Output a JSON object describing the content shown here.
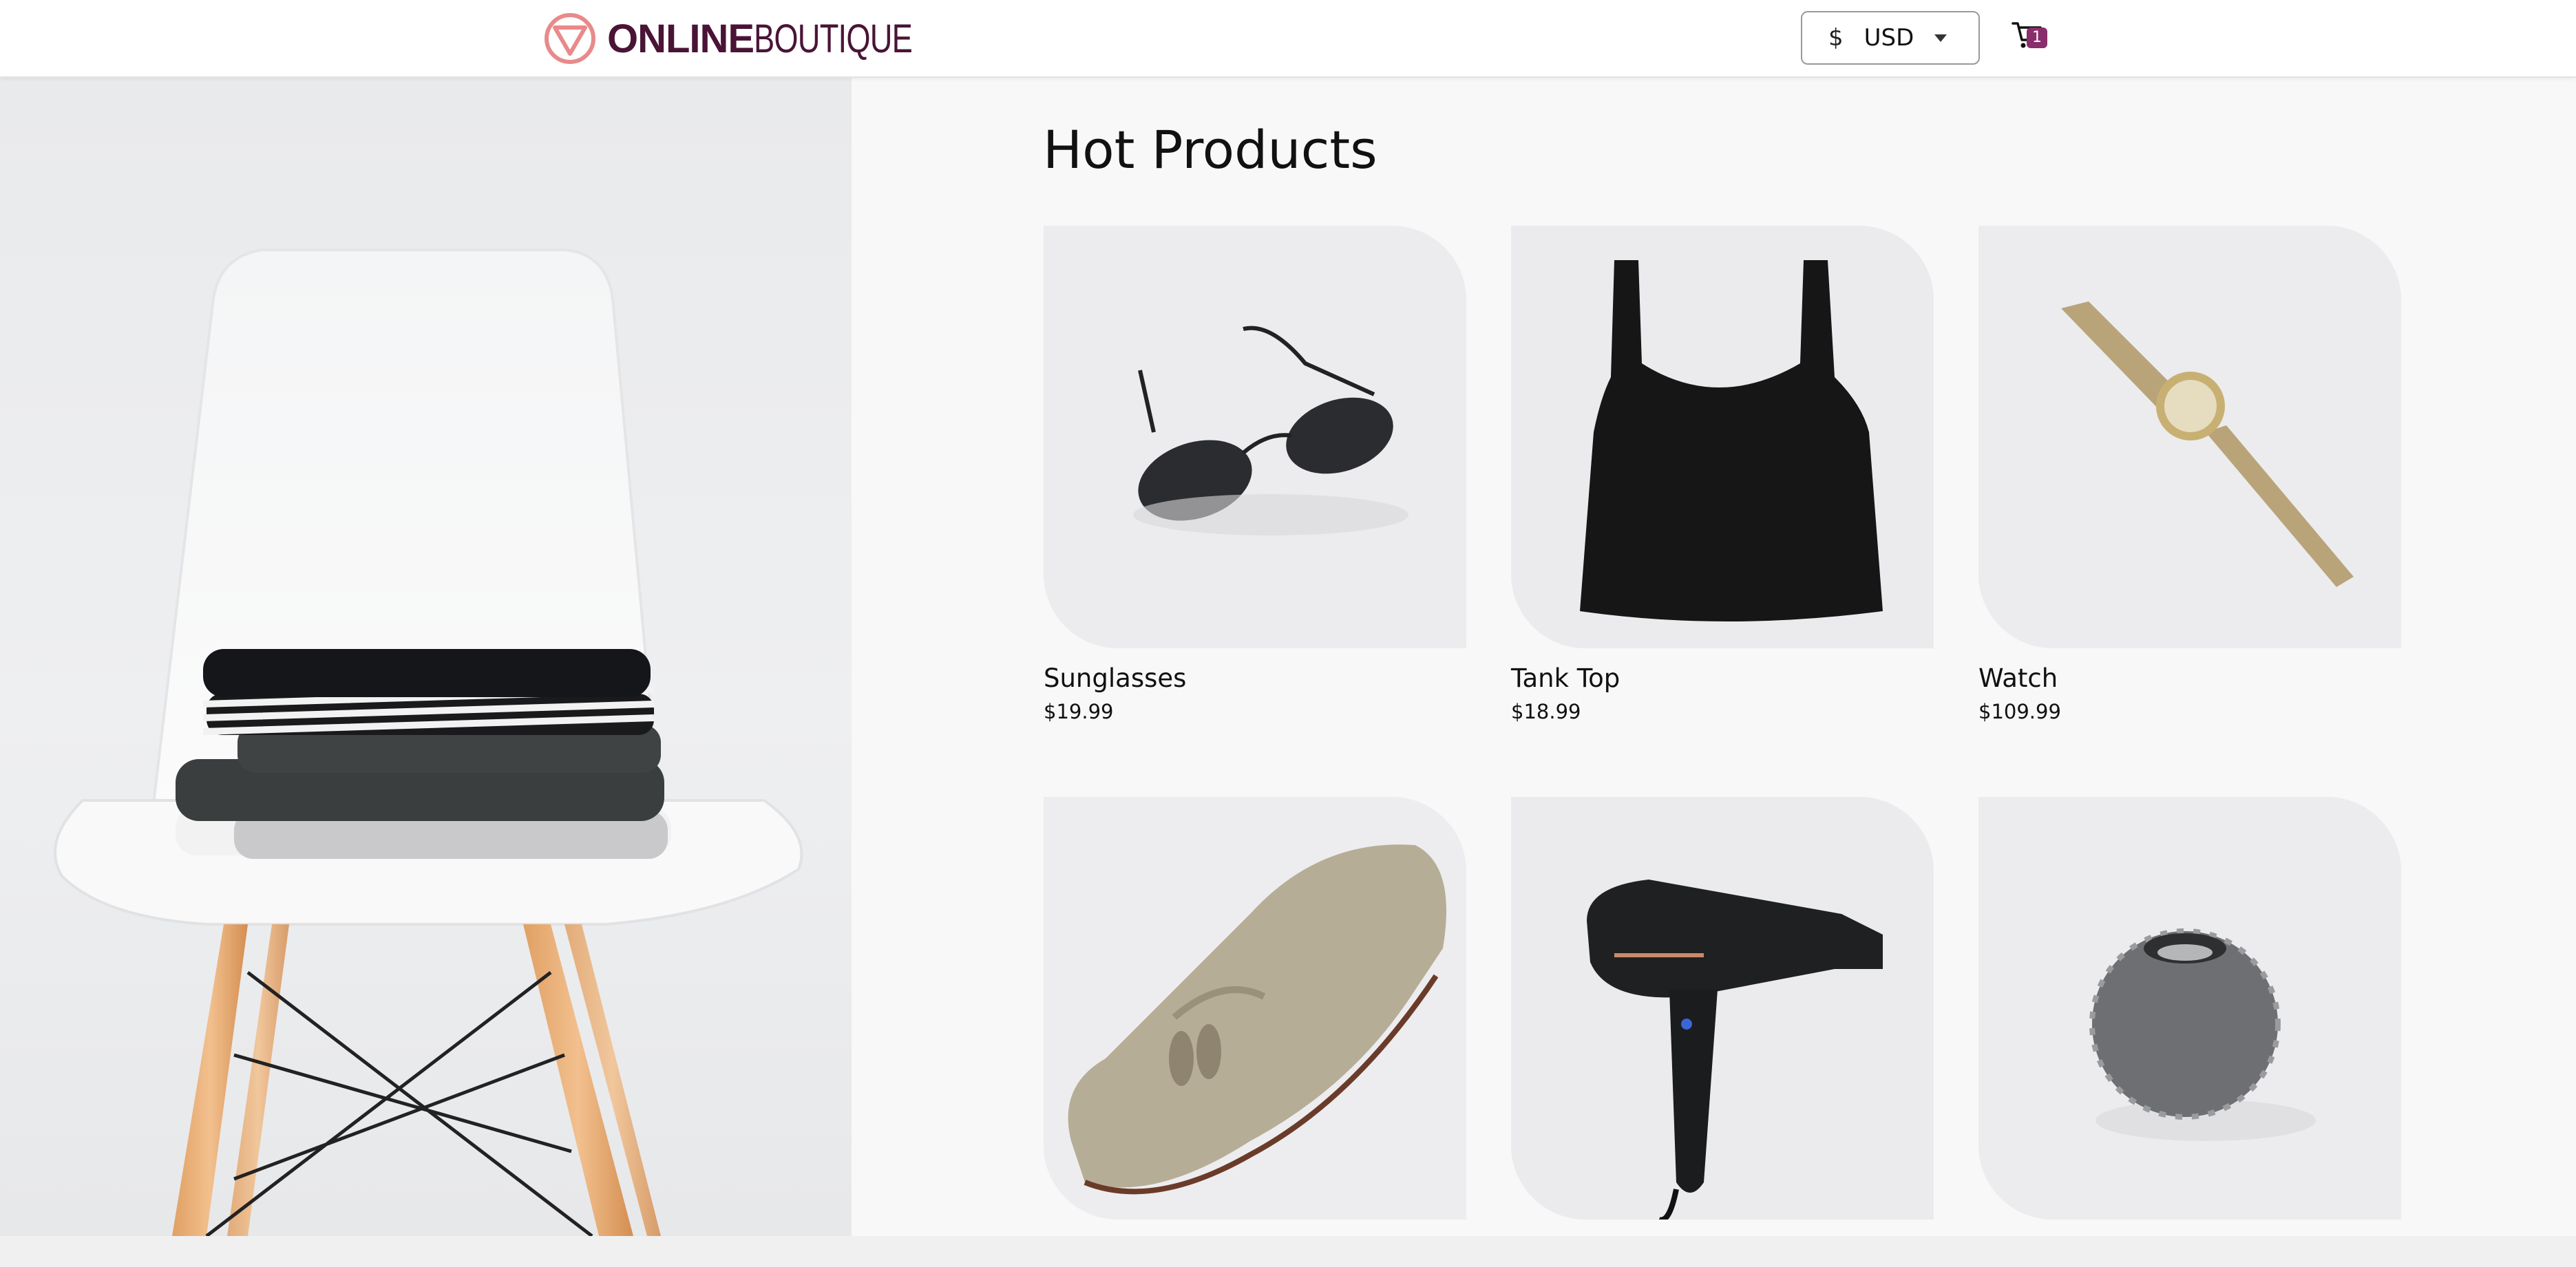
{
  "header": {
    "logo": {
      "bold": "ONLINE",
      "light": "BOUTIQUE"
    },
    "currency": {
      "symbol": "$",
      "code": "USD"
    },
    "cart": {
      "count": "1",
      "icon": "cart-icon"
    }
  },
  "colors": {
    "brand": "#4a1436",
    "accent": "#8a2d6b",
    "logo_mark": "#e98a8a"
  },
  "main": {
    "title": "Hot Products",
    "products": [
      {
        "name": "Sunglasses",
        "price": "$19.99",
        "image": "sunglasses-image"
      },
      {
        "name": "Tank Top",
        "price": "$18.99",
        "image": "tank-top-image"
      },
      {
        "name": "Watch",
        "price": "$109.99",
        "image": "watch-image"
      },
      {
        "name": "",
        "price": "",
        "image": "loafers-image"
      },
      {
        "name": "",
        "price": "",
        "image": "hair-dryer-image"
      },
      {
        "name": "",
        "price": "",
        "image": "candle-holder-image"
      }
    ]
  }
}
